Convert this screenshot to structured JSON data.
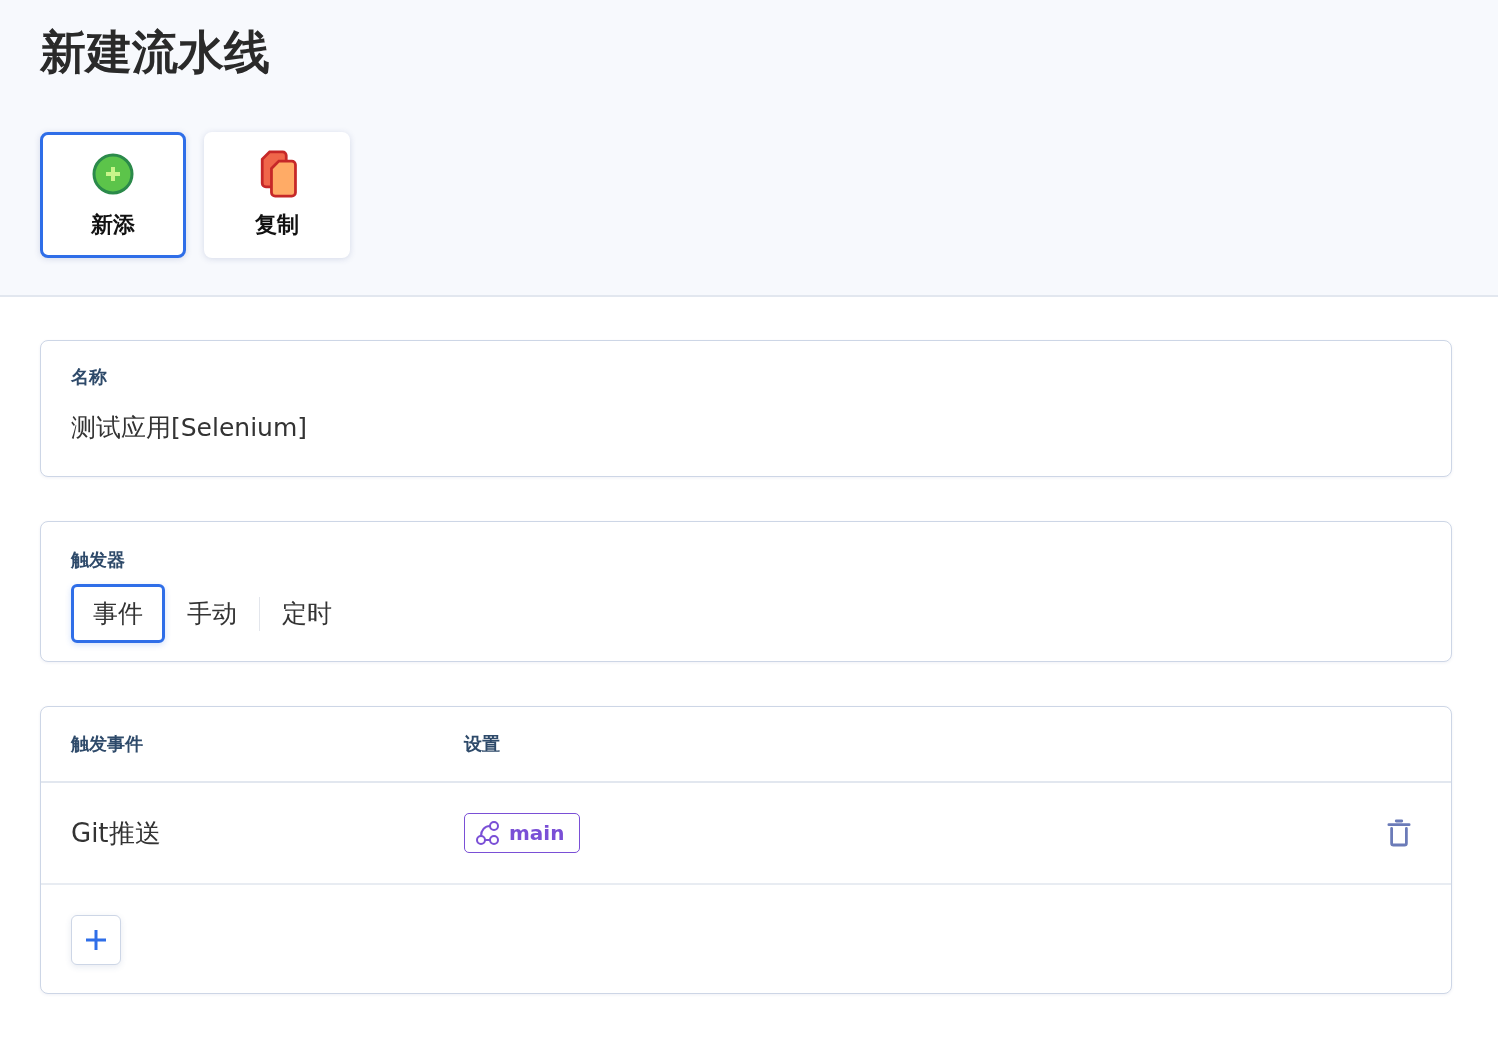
{
  "title": "新建流水线",
  "actions": [
    {
      "label": "新添",
      "kind": "add",
      "selected": true
    },
    {
      "label": "复制",
      "kind": "copy",
      "selected": false
    }
  ],
  "name_field": {
    "label": "名称",
    "value": "测试应用[Selenium]"
  },
  "trigger": {
    "label": "触发器",
    "options": [
      {
        "label": "事件",
        "selected": true
      },
      {
        "label": "手动",
        "selected": false
      },
      {
        "label": "定时",
        "selected": false
      }
    ]
  },
  "events": {
    "columns": [
      "触发事件",
      "设置"
    ],
    "rows": [
      {
        "event": "Git推送",
        "branch": "main"
      }
    ]
  }
}
